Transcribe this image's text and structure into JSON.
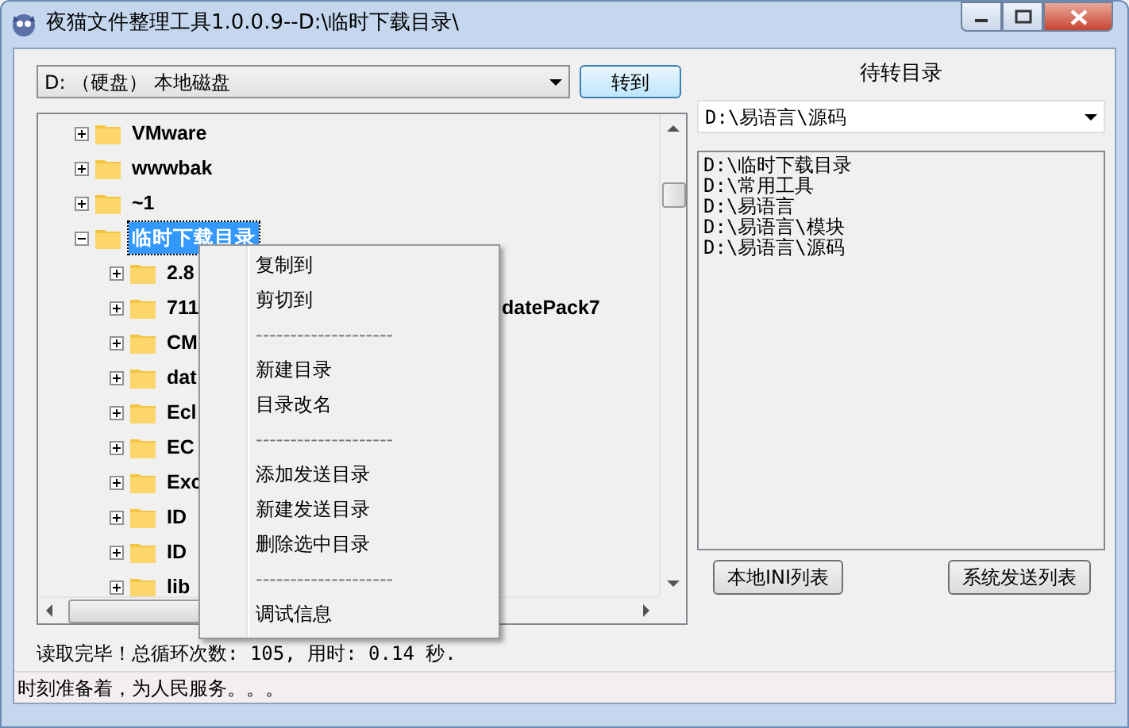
{
  "window": {
    "title": "夜猫文件整理工具1.0.0.9--D:\\临时下载目录\\"
  },
  "drive_select": {
    "value": "D: （硬盘） 本地磁盘"
  },
  "go_button": "转到",
  "tree": {
    "items": [
      {
        "label": "VMware",
        "expanded": false,
        "selected": false
      },
      {
        "label": "wwwbak",
        "expanded": false,
        "selected": false
      },
      {
        "label": "~1",
        "expanded": false,
        "selected": false
      },
      {
        "label": "临时下载目录",
        "expanded": true,
        "selected": true,
        "children": [
          {
            "label": "2.8",
            "expanded": false,
            "selected": false
          },
          {
            "label": "711",
            "tail": "datePack7",
            "expanded": false,
            "selected": false
          },
          {
            "label": "CM",
            "expanded": false,
            "selected": false
          },
          {
            "label": "dat",
            "expanded": false,
            "selected": false
          },
          {
            "label": "Ecl",
            "expanded": false,
            "selected": false
          },
          {
            "label": "EC",
            "expanded": false,
            "selected": false
          },
          {
            "label": "Exc",
            "expanded": false,
            "selected": false
          },
          {
            "label": "ID",
            "expanded": false,
            "selected": false
          },
          {
            "label": "ID",
            "expanded": false,
            "selected": false
          },
          {
            "label": "lib",
            "expanded": false,
            "selected": false
          }
        ]
      }
    ]
  },
  "context_menu": {
    "items": [
      {
        "kind": "item",
        "label": "复制到"
      },
      {
        "kind": "item",
        "label": "剪切到"
      },
      {
        "kind": "separator",
        "label": "--------------------"
      },
      {
        "kind": "item",
        "label": "新建目录"
      },
      {
        "kind": "item",
        "label": "目录改名"
      },
      {
        "kind": "separator",
        "label": "--------------------"
      },
      {
        "kind": "item",
        "label": "添加发送目录"
      },
      {
        "kind": "item",
        "label": "新建发送目录"
      },
      {
        "kind": "item",
        "label": "删除选中目录"
      },
      {
        "kind": "separator",
        "label": "--------------------"
      },
      {
        "kind": "item",
        "label": "调试信息"
      }
    ]
  },
  "target_panel": {
    "title": "待转目录",
    "select": {
      "value": "D:\\易语言\\源码"
    },
    "list": [
      "D:\\临时下载目录",
      "D:\\常用工具",
      "D:\\易语言",
      "D:\\易语言\\模块",
      "D:\\易语言\\源码"
    ],
    "buttons": [
      "本地INI列表",
      "系统发送列表"
    ]
  },
  "result_text": "读取完毕！总循环次数: 105, 用时: 0.14 秒.",
  "status_bar": "时刻准备着，为人民服务。。。"
}
